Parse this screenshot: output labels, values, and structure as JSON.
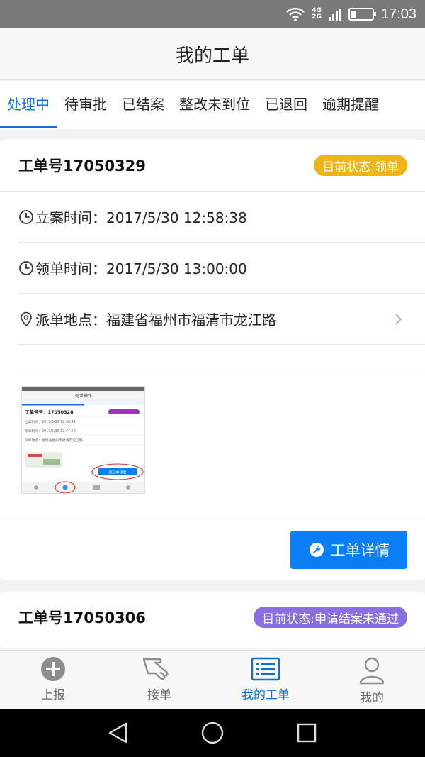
{
  "status_bar": {
    "time": "17:03",
    "net_top": "4G",
    "net_bottom": "2G"
  },
  "header": {
    "title": "我的工单"
  },
  "tabs": [
    {
      "label": "处理中"
    },
    {
      "label": "待审批"
    },
    {
      "label": "已结案"
    },
    {
      "label": "整改未到位"
    },
    {
      "label": "已退回"
    },
    {
      "label": "逾期提醒"
    }
  ],
  "orders": [
    {
      "order_no": "工单号17050329",
      "status": "目前状态:领单",
      "filed_time": "立案时间：2017/5/30 12:58:38",
      "claimed_time": "领单时间：2017/5/30 13:00:00",
      "location": "派单地点：福建省福州市福清市龙江路",
      "detail_button": "工单详情"
    },
    {
      "order_no": "工单号17050306",
      "status": "目前状态:申请结案未通过"
    }
  ],
  "thumbnail": {
    "title": "处单操作",
    "order": "工单号号：17050328",
    "line1": "立案时间：2017/5/30 12:58:44",
    "line2": "领单时间：2017/5/30 12:47:00",
    "line3": "派单地点：福建省福州市福清市龙江路",
    "button": "查工单详情"
  },
  "bottom_nav": [
    {
      "label": "上报",
      "icon": "plus-circle-icon"
    },
    {
      "label": "接单",
      "icon": "hand-icon"
    },
    {
      "label": "我的工单",
      "icon": "list-icon"
    },
    {
      "label": "我的",
      "icon": "user-icon"
    }
  ],
  "colors": {
    "accent": "#0a7ef5",
    "tab_active": "#1a6fd6",
    "badge_yellow": "#f0b416",
    "badge_purple": "#8a6fe0"
  }
}
